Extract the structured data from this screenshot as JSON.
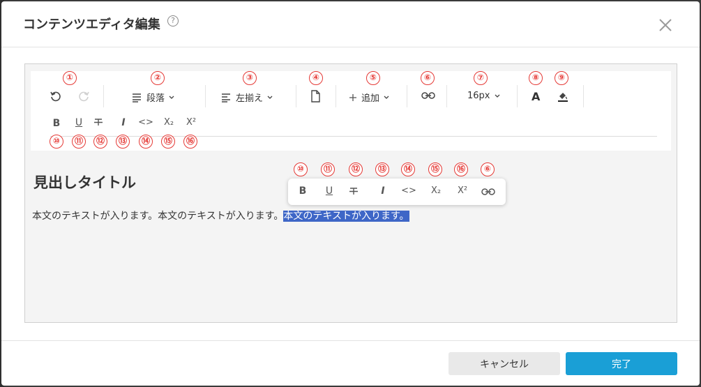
{
  "modal": {
    "title": "コンテンツエディタ編集",
    "help_icon": "?"
  },
  "toolbar": {
    "undo_icon": "undo-icon",
    "redo_icon": "redo-icon",
    "paragraph_label": "段落",
    "align_label": "左揃え",
    "add_label": "追加",
    "font_size_label": "16px",
    "font_color_label": "A",
    "format_buttons": {
      "bold": "B",
      "underline": "U",
      "strike": "S",
      "italic": "I",
      "code": "<>",
      "subscript": "X₂",
      "superscript": "X²"
    },
    "markers_row1": [
      "①",
      "②",
      "③",
      "④",
      "⑤",
      "⑥",
      "⑦",
      "⑧",
      "⑨"
    ],
    "markers_row2": [
      "⑩",
      "⑪",
      "⑫",
      "⑬",
      "⑭",
      "⑮",
      "⑯"
    ]
  },
  "content": {
    "heading": "見出しタイトル",
    "body_plain": "本文のテキストが入ります。本文のテキストが入ります。",
    "body_selected": "本文のテキストが入ります。"
  },
  "float_toolbar": {
    "markers": [
      "⑩",
      "⑪",
      "⑫",
      "⑬",
      "⑭",
      "⑮",
      "⑯",
      "⑥"
    ],
    "bold": "B",
    "underline": "U",
    "strike": "S",
    "italic": "I",
    "code": "<>",
    "subscript": "X₂",
    "superscript": "X²"
  },
  "footer": {
    "cancel_label": "キャンセル",
    "done_label": "完了"
  },
  "colors": {
    "accent": "#1a9fd6",
    "marker": "#e53935",
    "selection": "#3e66c7"
  }
}
